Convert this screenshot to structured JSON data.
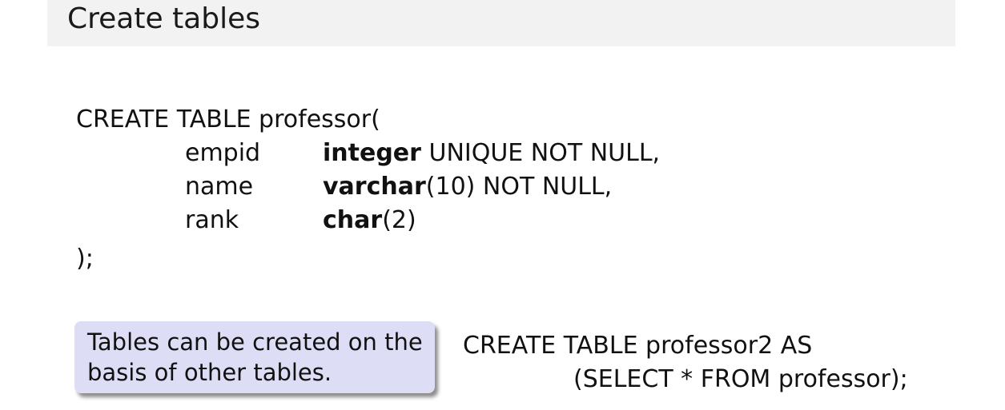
{
  "slide": {
    "title": "Create tables"
  },
  "sql_create": {
    "header": "CREATE TABLE professor(",
    "columns": [
      {
        "name": "empid",
        "type": "integer",
        "rest": " UNIQUE NOT NULL,"
      },
      {
        "name": "name",
        "type": "varchar",
        "rest": "(10) NOT NULL,"
      },
      {
        "name": "rank",
        "type": "char",
        "rest": "(2)"
      }
    ],
    "footer": ");"
  },
  "note": {
    "lines": [
      "Tables can be created on the",
      "basis of other tables."
    ]
  },
  "sql_copy": {
    "line1": "CREATE TABLE professor2 AS",
    "line2": "(SELECT * FROM professor);"
  },
  "colors": {
    "title_bar": "#f2f2f2",
    "note_box": "#ddddf6"
  }
}
